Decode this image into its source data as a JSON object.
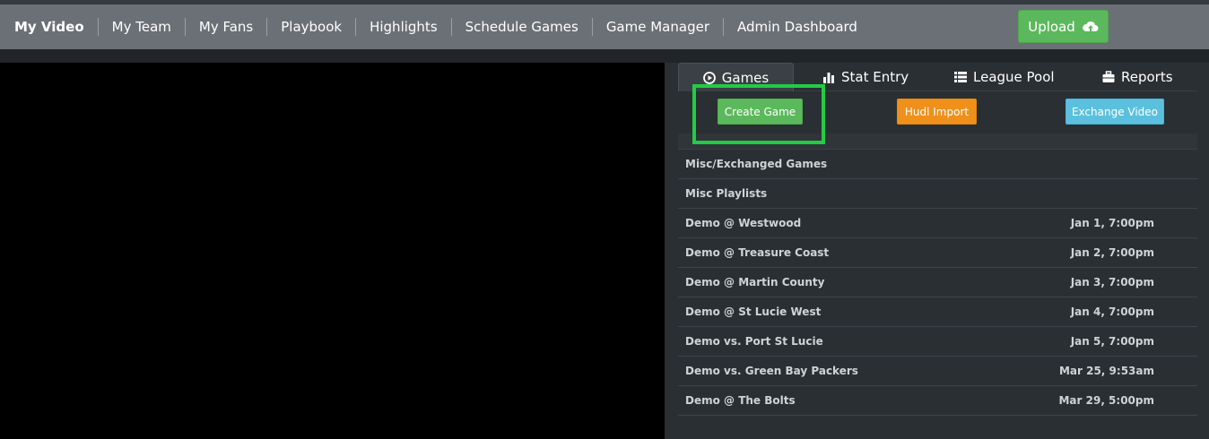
{
  "nav": {
    "items": [
      "My Video",
      "My Team",
      "My Fans",
      "Playbook",
      "Highlights",
      "Schedule Games",
      "Game Manager",
      "Admin Dashboard"
    ],
    "upload_label": "Upload"
  },
  "tabs": [
    {
      "label": "Games",
      "icon": "play-circle-icon",
      "active": true
    },
    {
      "label": "Stat Entry",
      "icon": "bar-chart-icon",
      "active": false
    },
    {
      "label": "League Pool",
      "icon": "list-icon",
      "active": false
    },
    {
      "label": "Reports",
      "icon": "briefcase-icon",
      "active": false
    }
  ],
  "actions": {
    "create_game": "Create Game",
    "hudl_import": "Hudl Import",
    "exchange_video": "Exchange Video"
  },
  "games": [
    {
      "name": "Misc/Exchanged Games",
      "date": ""
    },
    {
      "name": "Misc Playlists",
      "date": ""
    },
    {
      "name": "Demo @ Westwood",
      "date": "Jan 1, 7:00pm"
    },
    {
      "name": "Demo @ Treasure Coast",
      "date": "Jan 2, 7:00pm"
    },
    {
      "name": "Demo @ Martin County",
      "date": "Jan 3, 7:00pm"
    },
    {
      "name": "Demo @ St Lucie West",
      "date": "Jan 4, 7:00pm"
    },
    {
      "name": "Demo vs. Port St Lucie",
      "date": "Jan 5, 7:00pm"
    },
    {
      "name": "Demo vs. Green Bay Packers",
      "date": "Mar 25, 9:53am"
    },
    {
      "name": "Demo @ The Bolts",
      "date": "Mar 29, 5:00pm"
    }
  ],
  "colors": {
    "navbar": "#6b7076",
    "upload": "#5cb85c",
    "create_game": "#5cb85c",
    "hudl_import": "#f0901a",
    "exchange_video": "#5bc0de",
    "highlight": "#22cc44"
  }
}
